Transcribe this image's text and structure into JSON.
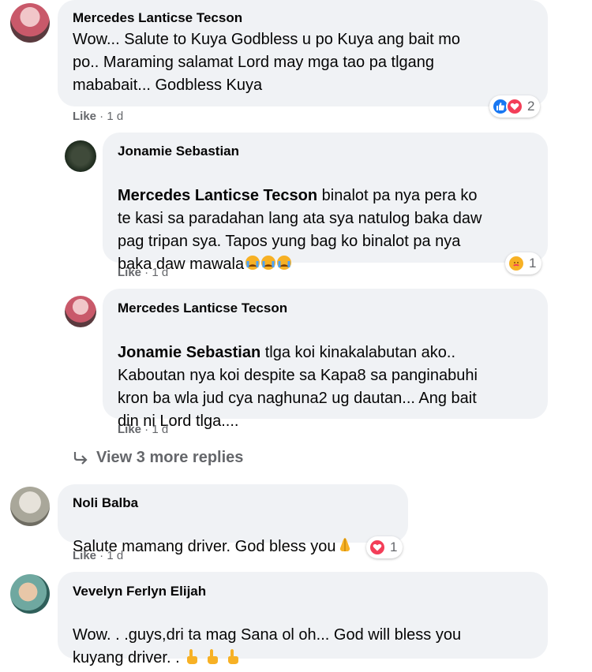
{
  "comments": [
    {
      "author": "Mercedes Lanticse Tecson",
      "text": "Wow... Salute to Kuya Godbless u po Kuya ang bait mo\npo.. Maraming salamat Lord may mga tao pa tlgang\nmababait... Godbless Kuya",
      "like_label": "Like",
      "time": "1 d",
      "reaction_count": "2",
      "reactions": [
        "like-icon",
        "love-icon"
      ]
    },
    {
      "author": "Jonamie Sebastian",
      "mention": "Mercedes Lanticse Tecson",
      "text_first": " binalot pa nya pera ko",
      "text_rest": "te kasi sa paradahan lang ata sya natulog baka daw\npag tripan sya. Tapos yung bag ko binalot pa nya\nbaka daw mawala",
      "like_label": "Like",
      "time": "1 d",
      "reaction_count": "1",
      "reactions": [
        "care-icon"
      ]
    },
    {
      "author": "Mercedes Lanticse Tecson",
      "mention": "Jonamie Sebastian",
      "text_first": " tlga koi kinakalabutan ako..",
      "text_rest": "Kaboutan nya koi despite sa Kapa8 sa panginabuhi\nkron ba wla jud cya naghuna2 ug dautan... Ang bait\ndin ni Lord tlga....",
      "like_label": "Like",
      "time": "1 d"
    },
    {
      "author": "Noli Balba",
      "text": "Salute mamang driver. God bless you",
      "like_label": "Like",
      "time": "1 d",
      "reaction_count": "1",
      "reactions": [
        "love-icon"
      ]
    },
    {
      "author": "Vevelyn Ferlyn Elijah",
      "text": "Wow. . .guys,dri ta mag Sana ol oh... God will bless you\nkuyang driver. . "
    }
  ],
  "view_more": "View 3 more replies",
  "colors": {
    "bubble": "#f0f2f5",
    "meta": "#65676b",
    "like_blue": "#1877f2",
    "love_red": "#f33e58"
  }
}
